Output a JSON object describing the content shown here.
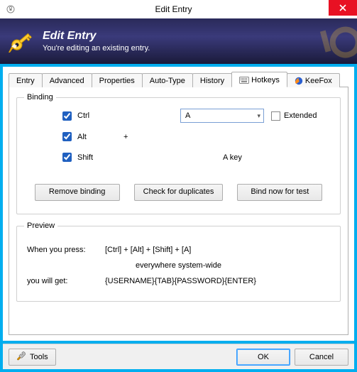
{
  "window": {
    "title": "Edit Entry",
    "close_tooltip": "Close"
  },
  "header": {
    "title": "Edit Entry",
    "subtitle": "You're editing an existing entry."
  },
  "tabs": {
    "entry": "Entry",
    "advanced": "Advanced",
    "properties": "Properties",
    "autotype": "Auto-Type",
    "history": "History",
    "hotkeys": "Hotkeys",
    "keefox": "KeeFox"
  },
  "binding": {
    "legend": "Binding",
    "ctrl_label": "Ctrl",
    "alt_label": "Alt",
    "shift_label": "Shift",
    "plus": "+",
    "key_selected": "A",
    "extended_label": "Extended",
    "a_key_label": "A key",
    "remove_btn": "Remove binding",
    "check_btn": "Check for duplicates",
    "bind_btn": "Bind now for test"
  },
  "preview": {
    "legend": "Preview",
    "press_label": "When you press:",
    "press_value": "[Ctrl] + [Alt] + [Shift] + [A]",
    "scope": "everywhere system-wide",
    "get_label": "you will get:",
    "get_value": "{USERNAME}{TAB}{PASSWORD}{ENTER}"
  },
  "footer": {
    "tools": "Tools",
    "ok": "OK",
    "cancel": "Cancel"
  }
}
